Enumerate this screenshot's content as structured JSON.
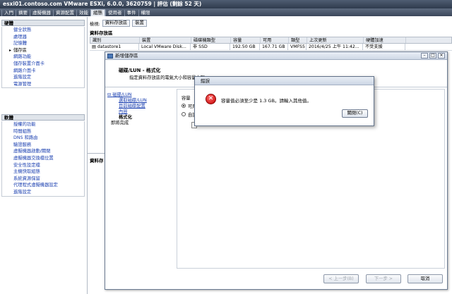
{
  "window": {
    "title": "esxi01.contoso.com VMware ESXi, 6.0.0, 3620759 | 評估 (剩餘 52 天)"
  },
  "top_tabs": [
    "入門",
    "摘要",
    "虛擬機器",
    "資源配置",
    "效能",
    "組態",
    "使用者",
    "事件",
    "權限"
  ],
  "left_panel": {
    "hardware_header": "硬體",
    "hardware_items": [
      "健全狀態",
      "處理器",
      "記憶體",
      "儲存區",
      "網路功能",
      "儲存裝置介面卡",
      "網路介面卡",
      "進階設定",
      "電源管理"
    ],
    "hardware_selected_index": 3,
    "software_header": "軟體",
    "software_items": [
      "授權的功能",
      "時間組態",
      "DNS 和路由",
      "驗證服務",
      "虛擬機器啟動/關閉",
      "虛擬機器交換檔位置",
      "安全性設定檔",
      "主機快取組態",
      "系統資源保留",
      "代理程式虛擬機器設定",
      "進階設定"
    ]
  },
  "view_bar": {
    "label": "檢視:",
    "buttons": [
      "資料存放區",
      "裝置"
    ]
  },
  "datastore_section": {
    "title": "資料存放區",
    "columns": [
      "識別",
      "裝置",
      "磁碟機類型",
      "容量",
      "可用",
      "類型",
      "上次更新",
      "硬體加速"
    ],
    "rows": [
      [
        "datastore1",
        "Local VMware Disk...",
        "非 SSD",
        "192.50 GB",
        "167.71 GB",
        "VMFS5",
        "2016/4/25 上午 11:42...",
        "不受支援"
      ]
    ]
  },
  "lower_section_title": "資料存",
  "wizard": {
    "title": "新增儲存區",
    "header_title": "磁碟/LUN - 格式化",
    "header_subtitle": "指定資料存放區的電氣大小和容量上限",
    "steps": [
      "磁碟/LUN",
      "選取磁碟/LUN",
      "目前磁碟配置",
      "內容",
      "格式化",
      "即將完成"
    ],
    "current_step_index": 4,
    "capacity_label": "容量",
    "radio_options": [
      "可用",
      "自訂"
    ],
    "buttons": {
      "back": "< 上一步(B)",
      "next": "下一步 >",
      "cancel": "取消"
    }
  },
  "error_dialog": {
    "title": "錯誤",
    "message": "容量值必須至少是 1.3 GB。請輸入其他值。",
    "close_button": "關閉(C)"
  }
}
